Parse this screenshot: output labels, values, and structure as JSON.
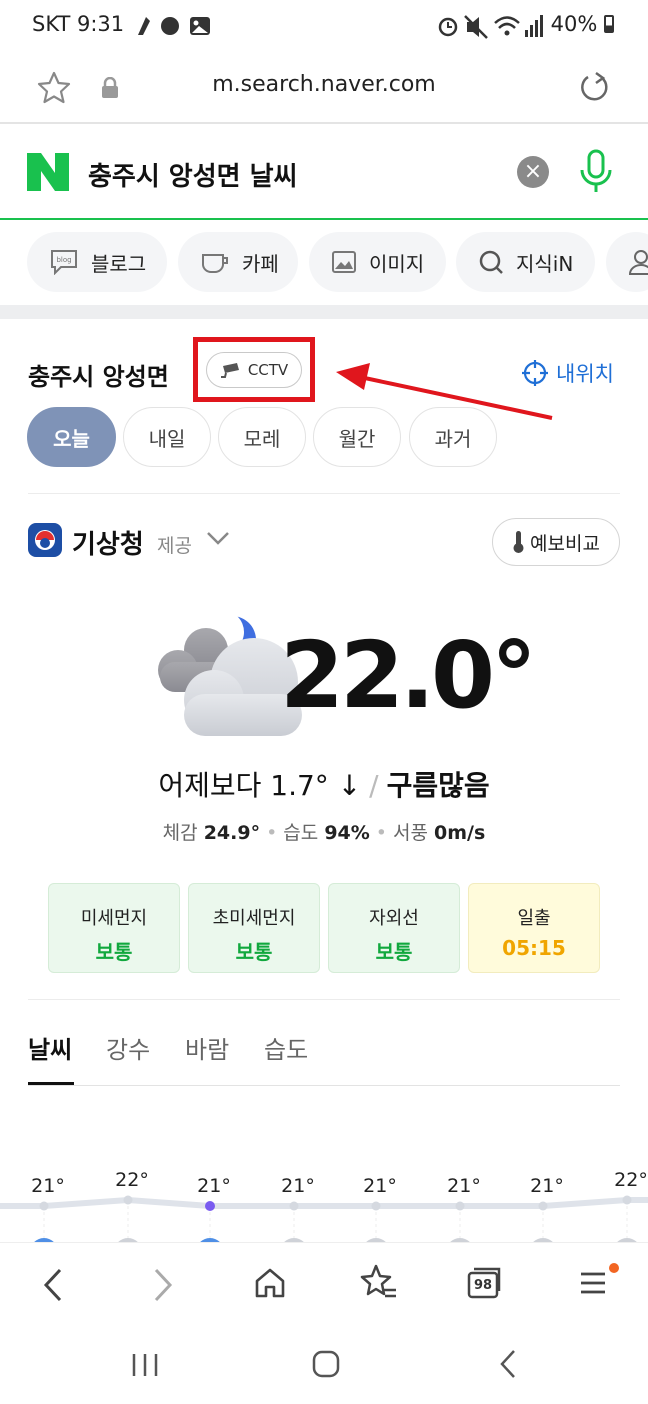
{
  "status_bar": {
    "time": "SKT 9:31",
    "battery": "40%"
  },
  "browser": {
    "url": "m.search.naver.com",
    "tabs_count": "98"
  },
  "search": {
    "query": "충주시 앙성면 날씨"
  },
  "categories": [
    {
      "label": "블로그",
      "icon": "blog-icon"
    },
    {
      "label": "카페",
      "icon": "cup-icon"
    },
    {
      "label": "이미지",
      "icon": "image-icon"
    },
    {
      "label": "지식iN",
      "icon": "search-icon"
    }
  ],
  "location": {
    "title": "충주시 앙성면",
    "cctv_label": "CCTV",
    "my_location_label": "내위치"
  },
  "day_tabs": [
    {
      "label": "오늘",
      "active": true
    },
    {
      "label": "내일",
      "active": false
    },
    {
      "label": "모레",
      "active": false
    },
    {
      "label": "월간",
      "active": false
    },
    {
      "label": "과거",
      "active": false
    }
  ],
  "provider": {
    "name": "기상청",
    "suffix": "제공",
    "compare_label": "예보비교"
  },
  "weather": {
    "temperature": "22.0°",
    "compare_text": "어제보다 1.7° ↓",
    "condition": "구름많음",
    "feels_like_label": "체감",
    "feels_like": "24.9°",
    "humidity_label": "습도",
    "humidity": "94%",
    "wind_label": "서풍",
    "wind": "0m/s"
  },
  "air_cards": [
    {
      "label": "미세먼지",
      "value": "보통"
    },
    {
      "label": "초미세먼지",
      "value": "보통"
    },
    {
      "label": "자외선",
      "value": "보통"
    },
    {
      "label": "일출",
      "value": "05:15"
    }
  ],
  "weather_tabs": [
    {
      "label": "날씨",
      "active": true
    },
    {
      "label": "강수",
      "active": false
    },
    {
      "label": "바람",
      "active": false
    },
    {
      "label": "습도",
      "active": false
    }
  ],
  "hourly": {
    "temps": [
      21,
      22,
      21,
      21,
      21,
      21,
      21,
      22
    ],
    "labels": [
      "21°",
      "22°",
      "21°",
      "21°",
      "21°",
      "21°",
      "21°",
      "22°"
    ],
    "current_index": 2
  },
  "colors": {
    "naver_green": "#19c14e",
    "annotation_red": "#e0161d",
    "link_blue": "#1f6fd6",
    "active_tab": "#7f93b7"
  }
}
